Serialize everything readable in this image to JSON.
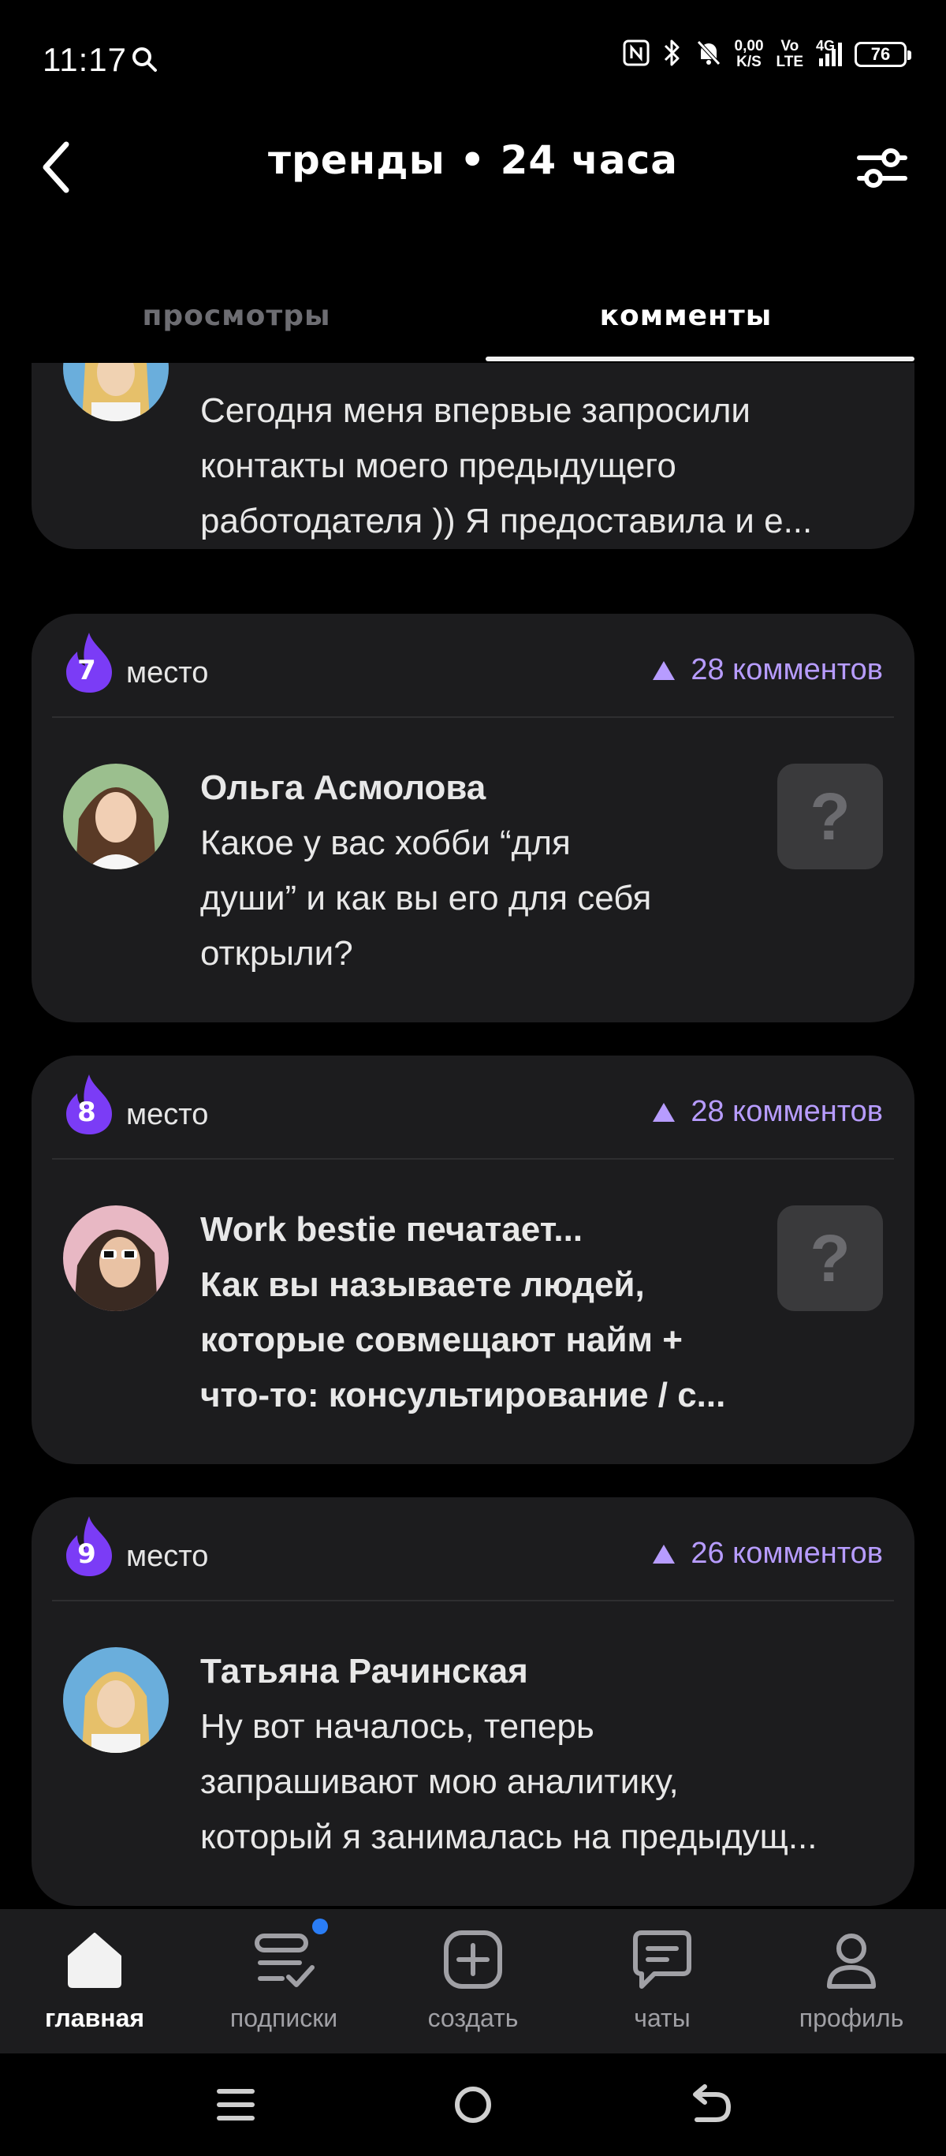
{
  "status_bar": {
    "time": "11:17",
    "net_speed_value": "0,00",
    "net_speed_unit": "K/S",
    "volte_top": "Vo",
    "volte_bottom": "LTE",
    "network": "4G",
    "battery": "76"
  },
  "header": {
    "title": "тренды • 24 часа"
  },
  "tabs": [
    {
      "label": "просмотры",
      "active": false
    },
    {
      "label": "комменты",
      "active": true
    }
  ],
  "cards": [
    {
      "rank": "",
      "rank_label": "",
      "comments": "",
      "author": "",
      "text_lines": [
        "Сегодня меня впервые запросили",
        "контакты моего предыдущего",
        "работодателя )) Я предоставила и е..."
      ]
    },
    {
      "rank": "7",
      "rank_label": "место",
      "comments": "28 комментов",
      "author": "Ольга Асмолова",
      "text_lines": [
        "Какое у вас хобби “для",
        "души” и как вы его для себя",
        "открыли?"
      ],
      "badge": "?"
    },
    {
      "rank": "8",
      "rank_label": "место",
      "comments": "28 комментов",
      "author": "Work bestie печатает...",
      "text_lines": [
        "Как вы называете людей,",
        "которые совмещают найм +",
        "что-то: консультирование / с..."
      ],
      "badge": "?"
    },
    {
      "rank": "9",
      "rank_label": "место",
      "comments": "26 комментов",
      "author": "Татьяна Рачинская",
      "text_lines": [
        "Ну вот началось, теперь",
        "запрашивают мою аналитику,",
        "который я занималась на предыдущ..."
      ]
    }
  ],
  "bottom_nav": [
    {
      "label": "главная",
      "icon": "home-icon",
      "active": true
    },
    {
      "label": "подписки",
      "icon": "subscriptions-icon",
      "active": false
    },
    {
      "label": "создать",
      "icon": "plus-square-icon",
      "active": false
    },
    {
      "label": "чаты",
      "icon": "chat-icon",
      "active": false
    },
    {
      "label": "профиль",
      "icon": "profile-icon",
      "active": false
    }
  ],
  "colors": {
    "accent": "#b79cff",
    "flame": "#7b3cf6",
    "card_bg": "#1c1c1e",
    "notification_dot": "#2a7df6"
  }
}
